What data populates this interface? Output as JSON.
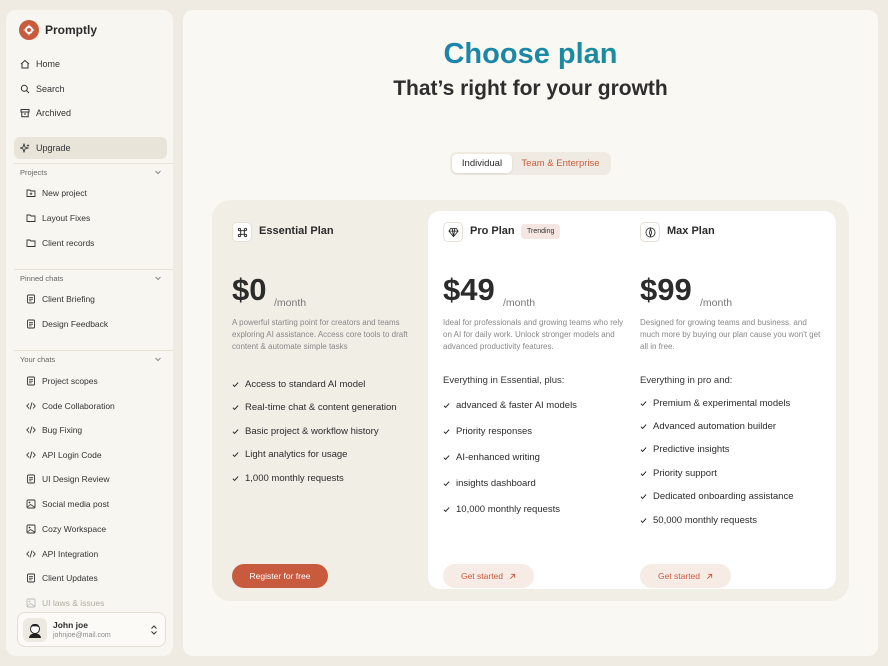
{
  "app": {
    "name": "Promptly",
    "accent": "#c85a3e"
  },
  "sidebar": {
    "nav": [
      {
        "label": "Home",
        "icon": "home-icon"
      },
      {
        "label": "Search",
        "icon": "search-icon"
      },
      {
        "label": "Archived",
        "icon": "archive-icon"
      },
      {
        "label": "Upgrade",
        "icon": "sparkle-icon",
        "active": true
      }
    ],
    "projects": {
      "title": "Projects",
      "items": [
        "New project",
        "Layout Fixes",
        "Client records"
      ]
    },
    "pinned": {
      "title": "Pinned chats",
      "items": [
        "Client Briefing",
        "Design Feedback"
      ]
    },
    "chats": {
      "title": "Your chats",
      "items": [
        {
          "label": "Project scopes",
          "icon": "document-icon"
        },
        {
          "label": "Code Collaboration",
          "icon": "code-icon"
        },
        {
          "label": "Bug Fixing",
          "icon": "code-icon"
        },
        {
          "label": "API Login Code",
          "icon": "code-icon"
        },
        {
          "label": "UI Design Review",
          "icon": "document-icon"
        },
        {
          "label": "Social media post",
          "icon": "image-icon"
        },
        {
          "label": "Cozy Workspace",
          "icon": "image-icon"
        },
        {
          "label": "API Integration",
          "icon": "code-icon"
        },
        {
          "label": "Client Updates",
          "icon": "document-icon"
        },
        {
          "label": "UI laws & issues",
          "icon": "image-icon"
        }
      ]
    },
    "user": {
      "name": "John joe",
      "email": "johnjoe@mail.com"
    }
  },
  "main": {
    "headline": "Choose plan",
    "subheadline": "That’s right for your growth",
    "toggle": {
      "individual": "Individual",
      "team": "Team & Enterprise",
      "selected": "Individual"
    }
  },
  "plans": [
    {
      "name": "Essential Plan",
      "icon": "command-icon",
      "price": "$0",
      "period": "/month",
      "description": "A powerful starting point for creators and teams exploring AI assistance. Access core tools to draft content & automate simple tasks",
      "intro": "",
      "features": [
        "Access to standard AI model",
        "Real-time chat & content generation",
        "Basic project & workflow history",
        "Light analytics for usage",
        "1,000 monthly requests"
      ],
      "cta": "Register for free"
    },
    {
      "name": "Pro Plan",
      "icon": "diamond-icon",
      "badge": "Trending",
      "price": "$49",
      "period": "/month",
      "description": "Ideal for professionals and growing teams who rely on AI for daily work. Unlock stronger models and advanced productivity features.",
      "intro": "Everything in Essential, plus:",
      "features": [
        "advanced & faster AI models",
        "Priority responses",
        "AI-enhanced writing",
        "insights dashboard",
        "10,000 monthly requests"
      ],
      "cta": "Get started"
    },
    {
      "name": "Max Plan",
      "icon": "compass-icon",
      "price": "$99",
      "period": "/month",
      "description": "Designed for growing teams and business. and much more by buying our plan cause you won't get all in free.",
      "intro": "Everything in pro and:",
      "features": [
        "Premium & experimental models",
        "Advanced automation builder",
        "Predictive insights",
        "Priority support",
        "Dedicated onboarding assistance",
        "50,000 monthly requests"
      ],
      "cta": "Get started"
    }
  ]
}
